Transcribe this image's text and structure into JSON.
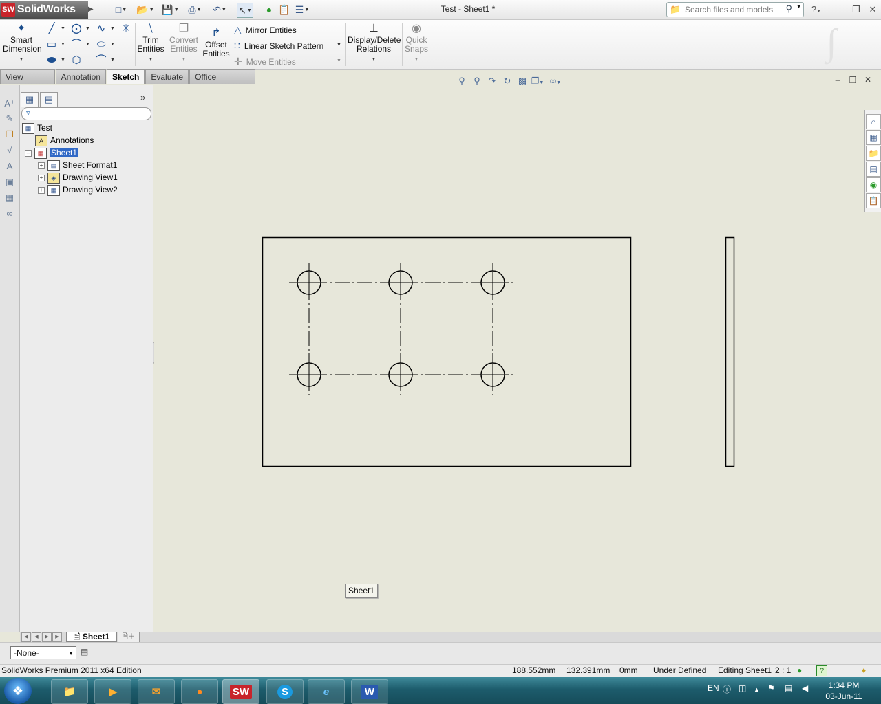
{
  "app": {
    "logo_mark": "SW",
    "logo_text": "SolidWorks",
    "doc_title": "Test - Sheet1 *"
  },
  "quick_access": [
    "new-icon",
    "open-icon",
    "save-icon",
    "print-icon",
    "undo-icon",
    "select-icon",
    "rebuild-icon",
    "file-properties-icon",
    "options-icon"
  ],
  "search": {
    "placeholder": "Search files and models"
  },
  "ribbon": {
    "smart_dimension": [
      "Smart",
      "Dimension"
    ],
    "trim": [
      "Trim",
      "Entities"
    ],
    "convert": [
      "Convert",
      "Entities"
    ],
    "offset": [
      "Offset",
      "Entities"
    ],
    "mirror": "Mirror Entities",
    "linear_pattern": "Linear Sketch Pattern",
    "move": "Move Entities",
    "display_delete": [
      "Display/Delete",
      "Relations"
    ],
    "quick_snaps": [
      "Quick",
      "Snaps"
    ]
  },
  "tabs": [
    "View Layout",
    "Annotation",
    "Sketch",
    "Evaluate",
    "Office Products"
  ],
  "active_tab": "Sketch",
  "tree": {
    "root": "Test",
    "items": [
      {
        "label": "Annotations",
        "icon": "annotations-icon"
      },
      {
        "label": "Sheet1",
        "icon": "sheet-icon",
        "selected": true
      },
      {
        "label": "Sheet Format1",
        "icon": "sheet-format-icon"
      },
      {
        "label": "Drawing View1",
        "icon": "drawing-view-icon"
      },
      {
        "label": "Drawing View2",
        "icon": "drawing-view-icon"
      }
    ]
  },
  "drawing": {
    "sheet_tag": "Sheet1"
  },
  "sheet_tabs": {
    "active": "Sheet1"
  },
  "config": {
    "value": "-None-"
  },
  "status": {
    "edition": "SolidWorks Premium 2011 x64 Edition",
    "x": "188.552mm",
    "y": "132.391mm",
    "z": "0mm",
    "state": "Under Defined",
    "editing": "Editing Sheet1",
    "scale": "2 : 1",
    "help": "?"
  },
  "taskbar": {
    "apps": [
      "Explorer",
      "Media Player",
      "Outlook",
      "Firefox",
      "SolidWorks",
      "Skype",
      "Internet Explorer",
      "Word"
    ],
    "lang": "EN",
    "time": "1:34 PM",
    "date": "03-Jun-11"
  },
  "colors": {
    "canvas": "#e7e7da",
    "selection": "#3169c6",
    "taskbar": "#1d5c6c",
    "brand_red": "#c8242b"
  }
}
